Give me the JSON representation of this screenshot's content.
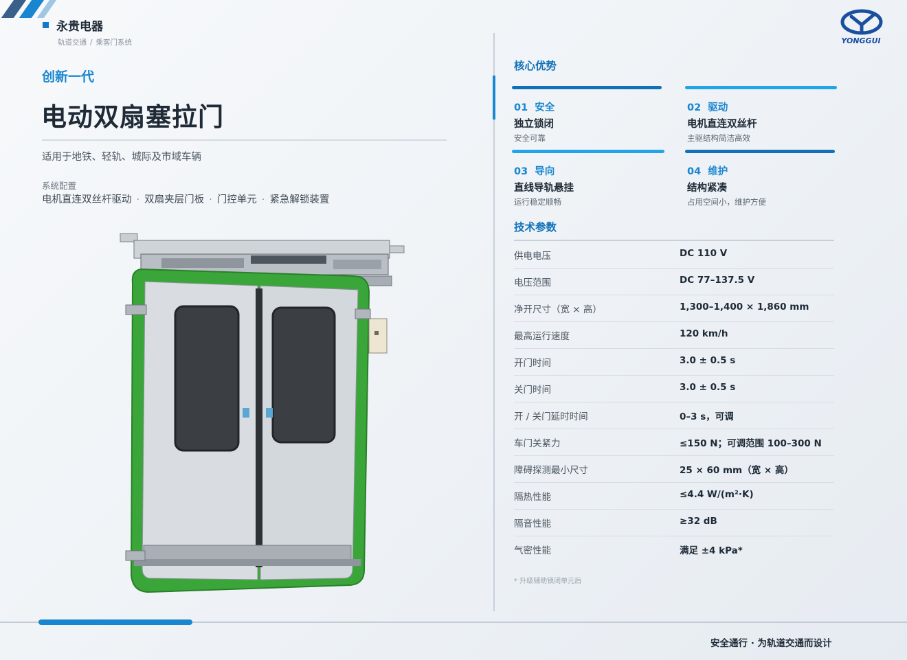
{
  "brand": {
    "name": "永贵电器",
    "logo_text": "YONGGUI"
  },
  "breadcrumb": [
    "轨道交通",
    "乘客门系统"
  ],
  "breadcrumb_sep": "/",
  "subtitle": "创新一代",
  "title": "电动双扇塞拉门",
  "applicability": "适用于地铁、轻轨、城际及市域车辆",
  "config": {
    "label": "系统配置",
    "items": [
      "电机直连双丝杆驱动",
      "双扇夹层门板",
      "门控单元",
      "紧急解锁装置"
    ],
    "separator": "·"
  },
  "advantages": {
    "title": "核心优势",
    "items": [
      {
        "num": "01",
        "tag": "安全",
        "head": "独立锁闭",
        "desc": "安全可靠"
      },
      {
        "num": "02",
        "tag": "驱动",
        "head": "电机直连双丝杆",
        "desc": "主驱结构简洁高效"
      },
      {
        "num": "03",
        "tag": "导向",
        "head": "直线导轨悬挂",
        "desc": "运行稳定顺畅"
      },
      {
        "num": "04",
        "tag": "维护",
        "head": "结构紧凑",
        "desc": "占用空间小，维护方便"
      }
    ]
  },
  "specs": {
    "title": "技术参数",
    "rows": [
      {
        "label": "供电电压",
        "value": "DC 110 V"
      },
      {
        "label": "电压范围",
        "value": "DC 77–137.5 V"
      },
      {
        "label": "净开尺寸（宽 × 高）",
        "value": "1,300–1,400 × 1,860 mm"
      },
      {
        "label": "最高运行速度",
        "value": "120 km/h"
      },
      {
        "label": "开门时间",
        "value": "3.0 ± 0.5 s"
      },
      {
        "label": "关门时间",
        "value": "3.0 ± 0.5 s"
      },
      {
        "label": "开 / 关门延时时间",
        "value": "0–3 s，可调"
      },
      {
        "label": "车门关紧力",
        "value": "≤150 N；可调范围 100–300 N"
      },
      {
        "label": "障碍探测最小尺寸",
        "value": "25 × 60 mm（宽 × 高）"
      },
      {
        "label": "隔热性能",
        "value": "≤4.4 W/(m²·K)"
      },
      {
        "label": "隔音性能",
        "value": "≥32 dB"
      },
      {
        "label": "气密性能",
        "value": "满足 ±4 kPa*"
      }
    ],
    "footnote": "* 升级辅助锁闭单元后"
  },
  "slogan": "安全通行 · 为轨道交通而设计",
  "colors": {
    "accent": "#1a86cf",
    "accent_dark": "#1070b8",
    "text": "#1e2a36",
    "door_seal": "#3aa63a",
    "door_panel": "#d9dde1"
  },
  "icons": {
    "logo": "yonggui-logo",
    "door": "plug-sliding-door-illustration"
  }
}
